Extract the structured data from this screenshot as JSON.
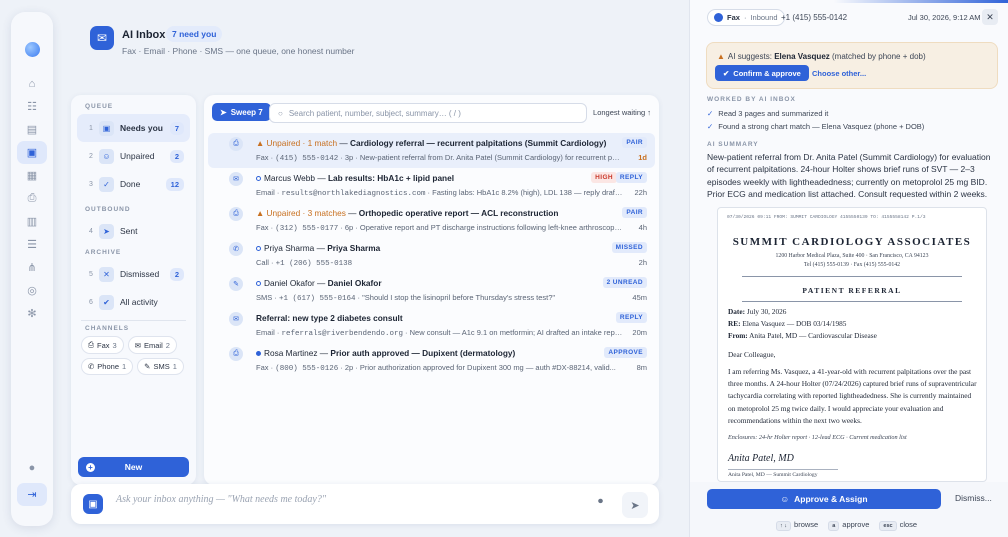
{
  "app": {
    "title": "AI Inbox",
    "need_badge": "7 need you",
    "subtitle": "Fax · Email · Phone · SMS — one queue, one honest number"
  },
  "rail": {
    "icons": [
      "home-icon",
      "people-icon",
      "chart-icon",
      "inbox-icon",
      "grid-icon",
      "printer-icon",
      "calendar-icon",
      "user-list-icon",
      "share-icon",
      "target-icon",
      "settings-icon"
    ],
    "bottom": [
      "avatar-icon",
      "logout-icon"
    ]
  },
  "queue": {
    "heading": "QUEUE",
    "items": [
      {
        "num": "1",
        "label": "Needs you",
        "count": "7"
      },
      {
        "num": "2",
        "label": "Unpaired",
        "count": "2"
      },
      {
        "num": "3",
        "label": "Done",
        "count": "12"
      }
    ]
  },
  "outbound": {
    "heading": "OUTBOUND",
    "items": [
      {
        "num": "4",
        "label": "Sent"
      }
    ]
  },
  "archive": {
    "heading": "ARCHIVE",
    "items": [
      {
        "num": "5",
        "label": "Dismissed",
        "count": "2"
      },
      {
        "num": "6",
        "label": "All activity"
      }
    ]
  },
  "channels": {
    "heading": "CHANNELS",
    "items": [
      {
        "label": "Fax",
        "count": "3"
      },
      {
        "label": "Email",
        "count": "2"
      },
      {
        "label": "Phone",
        "count": "1"
      },
      {
        "label": "SMS",
        "count": "1"
      }
    ]
  },
  "new_button": "New",
  "toolbar": {
    "sweep": "Sweep 7",
    "search_placeholder": "Search patient, number, subject, summary…  ( / )",
    "sort": "Longest waiting ↑"
  },
  "rows": [
    {
      "prefix": "Unpaired · 1 match",
      "name": "",
      "subject": "Cardiology referral — recurrent palpitations (Summit Cardiology)",
      "channel": "Fax",
      "from": "(415) 555-0142",
      "extra": "3p",
      "snippet": "New-patient referral from Dr. Anita Patel (Summit Cardiology) for recurrent palpitations — Holter, ECG...",
      "tag": "PAIR",
      "time": "1d"
    },
    {
      "prefix": "",
      "name": "Marcus Webb",
      "subject": "Lab results: HbA1c + lipid panel",
      "channel": "Email",
      "from": "results@northlakediagnostics.com",
      "extra": "",
      "snippet": "Fasting labs: HbA1c 8.2% (high), LDL 138 — reply drafted for your...",
      "tag": "HIGH",
      "tag2": "REPLY",
      "time": "22h"
    },
    {
      "prefix": "Unpaired · 3 matches",
      "name": "",
      "subject": "Orthopedic operative report — ACL reconstruction",
      "channel": "Fax",
      "from": "(312) 555-0177",
      "extra": "6p",
      "snippet": "Operative report and PT discharge instructions following left-knee arthroscopic...",
      "tag": "PAIR",
      "time": "4h"
    },
    {
      "prefix": "",
      "name": "Priya Sharma",
      "subject": "Priya Sharma",
      "channel": "Call",
      "from": "+1 (206) 555-0138",
      "extra": "",
      "snippet": "",
      "tag": "MISSED",
      "time": "2h"
    },
    {
      "prefix": "",
      "name": "Daniel Okafor",
      "subject": "Daniel Okafor",
      "channel": "SMS",
      "from": "+1 (617) 555-0164",
      "extra": "",
      "snippet": "\"Should I stop the lisinopril before Thursday's stress test?\"",
      "tag": "2 UNREAD",
      "time": "45m"
    },
    {
      "prefix": "",
      "name": "",
      "subject": "Referral: new type 2 diabetes consult",
      "channel": "Email",
      "from": "referrals@riverbendendo.org",
      "extra": "",
      "snippet": "New consult — A1c 9.1 on metformin; AI drafted an intake reply with ne...",
      "tag": "REPLY",
      "time": "20m"
    },
    {
      "prefix": "",
      "name": "Rosa Martinez",
      "subject": "Prior auth approved — Dupixent (dermatology)",
      "channel": "Fax",
      "from": "(800) 555-0126",
      "extra": "2p",
      "snippet": "Prior authorization approved for Dupixent 300 mg — auth #DX-88214, valid...",
      "tag": "APPROVE",
      "time": "8m"
    }
  ],
  "ask": {
    "placeholder": "Ask your inbox anything — \"What needs me today?\""
  },
  "detail": {
    "channel": "Fax",
    "direction": "Inbound",
    "phone": "+1 (415) 555-0142",
    "date": "Jul 30, 2026, 9:12 AM",
    "suggest_prefix": "AI suggests:",
    "suggest_name": "Elena Vasquez",
    "suggest_suffix": "(matched by phone + dob)",
    "confirm": "Confirm & approve",
    "other": "Choose other...",
    "worked_heading": "WORKED BY AI INBOX",
    "worked": [
      "Read 3 pages and summarized it",
      "Found a strong chart match — Elena Vasquez (phone + DOB)"
    ],
    "summary_heading": "AI SUMMARY",
    "summary": "New-patient referral from Dr. Anita Patel (Summit Cardiology) for evaluation of recurrent palpitations. 24-hour Holter shows brief runs of SVT — 2–3 episodes weekly with lightheadedness; currently on metoprolol 25 mg BID. Prior ECG and medication list attached. Consult requested within 2 weeks.",
    "approve": "Approve & Assign",
    "dismiss": "Dismiss...",
    "hints": [
      {
        "key": "↑ ↓",
        "label": "browse"
      },
      {
        "key": "a",
        "label": "approve"
      },
      {
        "key": "esc",
        "label": "close"
      }
    ]
  },
  "fax_doc": {
    "header": "07/30/2026 09:11  FROM: SUMMIT CARDIOLOGY 4155550139  TO: 4155558142  P.1/3",
    "org": "SUMMIT CARDIOLOGY ASSOCIATES",
    "addr1": "1200 Harbor Medical Plaza, Suite 400 · San Francisco, CA 94123",
    "addr2": "Tel (415) 555-0139 · Fax (415) 555-0142",
    "title": "PATIENT REFERRAL",
    "date_label": "Date:",
    "date": "July 30, 2026",
    "re_label": "RE:",
    "re": "Elena Vasquez — DOB 03/14/1985",
    "from_label": "From:",
    "from": "Anita Patel, MD — Cardiovascular Disease",
    "greeting": "Dear Colleague,",
    "body": "I am referring Ms. Vasquez, a 41-year-old with recurrent palpitations over the past three months. A 24-hour Holter (07/24/2026) captured brief runs of supraventricular tachycardia correlating with reported lightheadedness. She is currently maintained on metoprolol 25 mg twice daily. I would appreciate your evaluation and recommendations within the next two weeks.",
    "enclosures": "Enclosures: 24-hr Holter report · 12-lead ECG · Current medication list",
    "signature": "Anita Patel, MD",
    "sig_sub": "Anita Patel, MD — Summit Cardiology"
  }
}
